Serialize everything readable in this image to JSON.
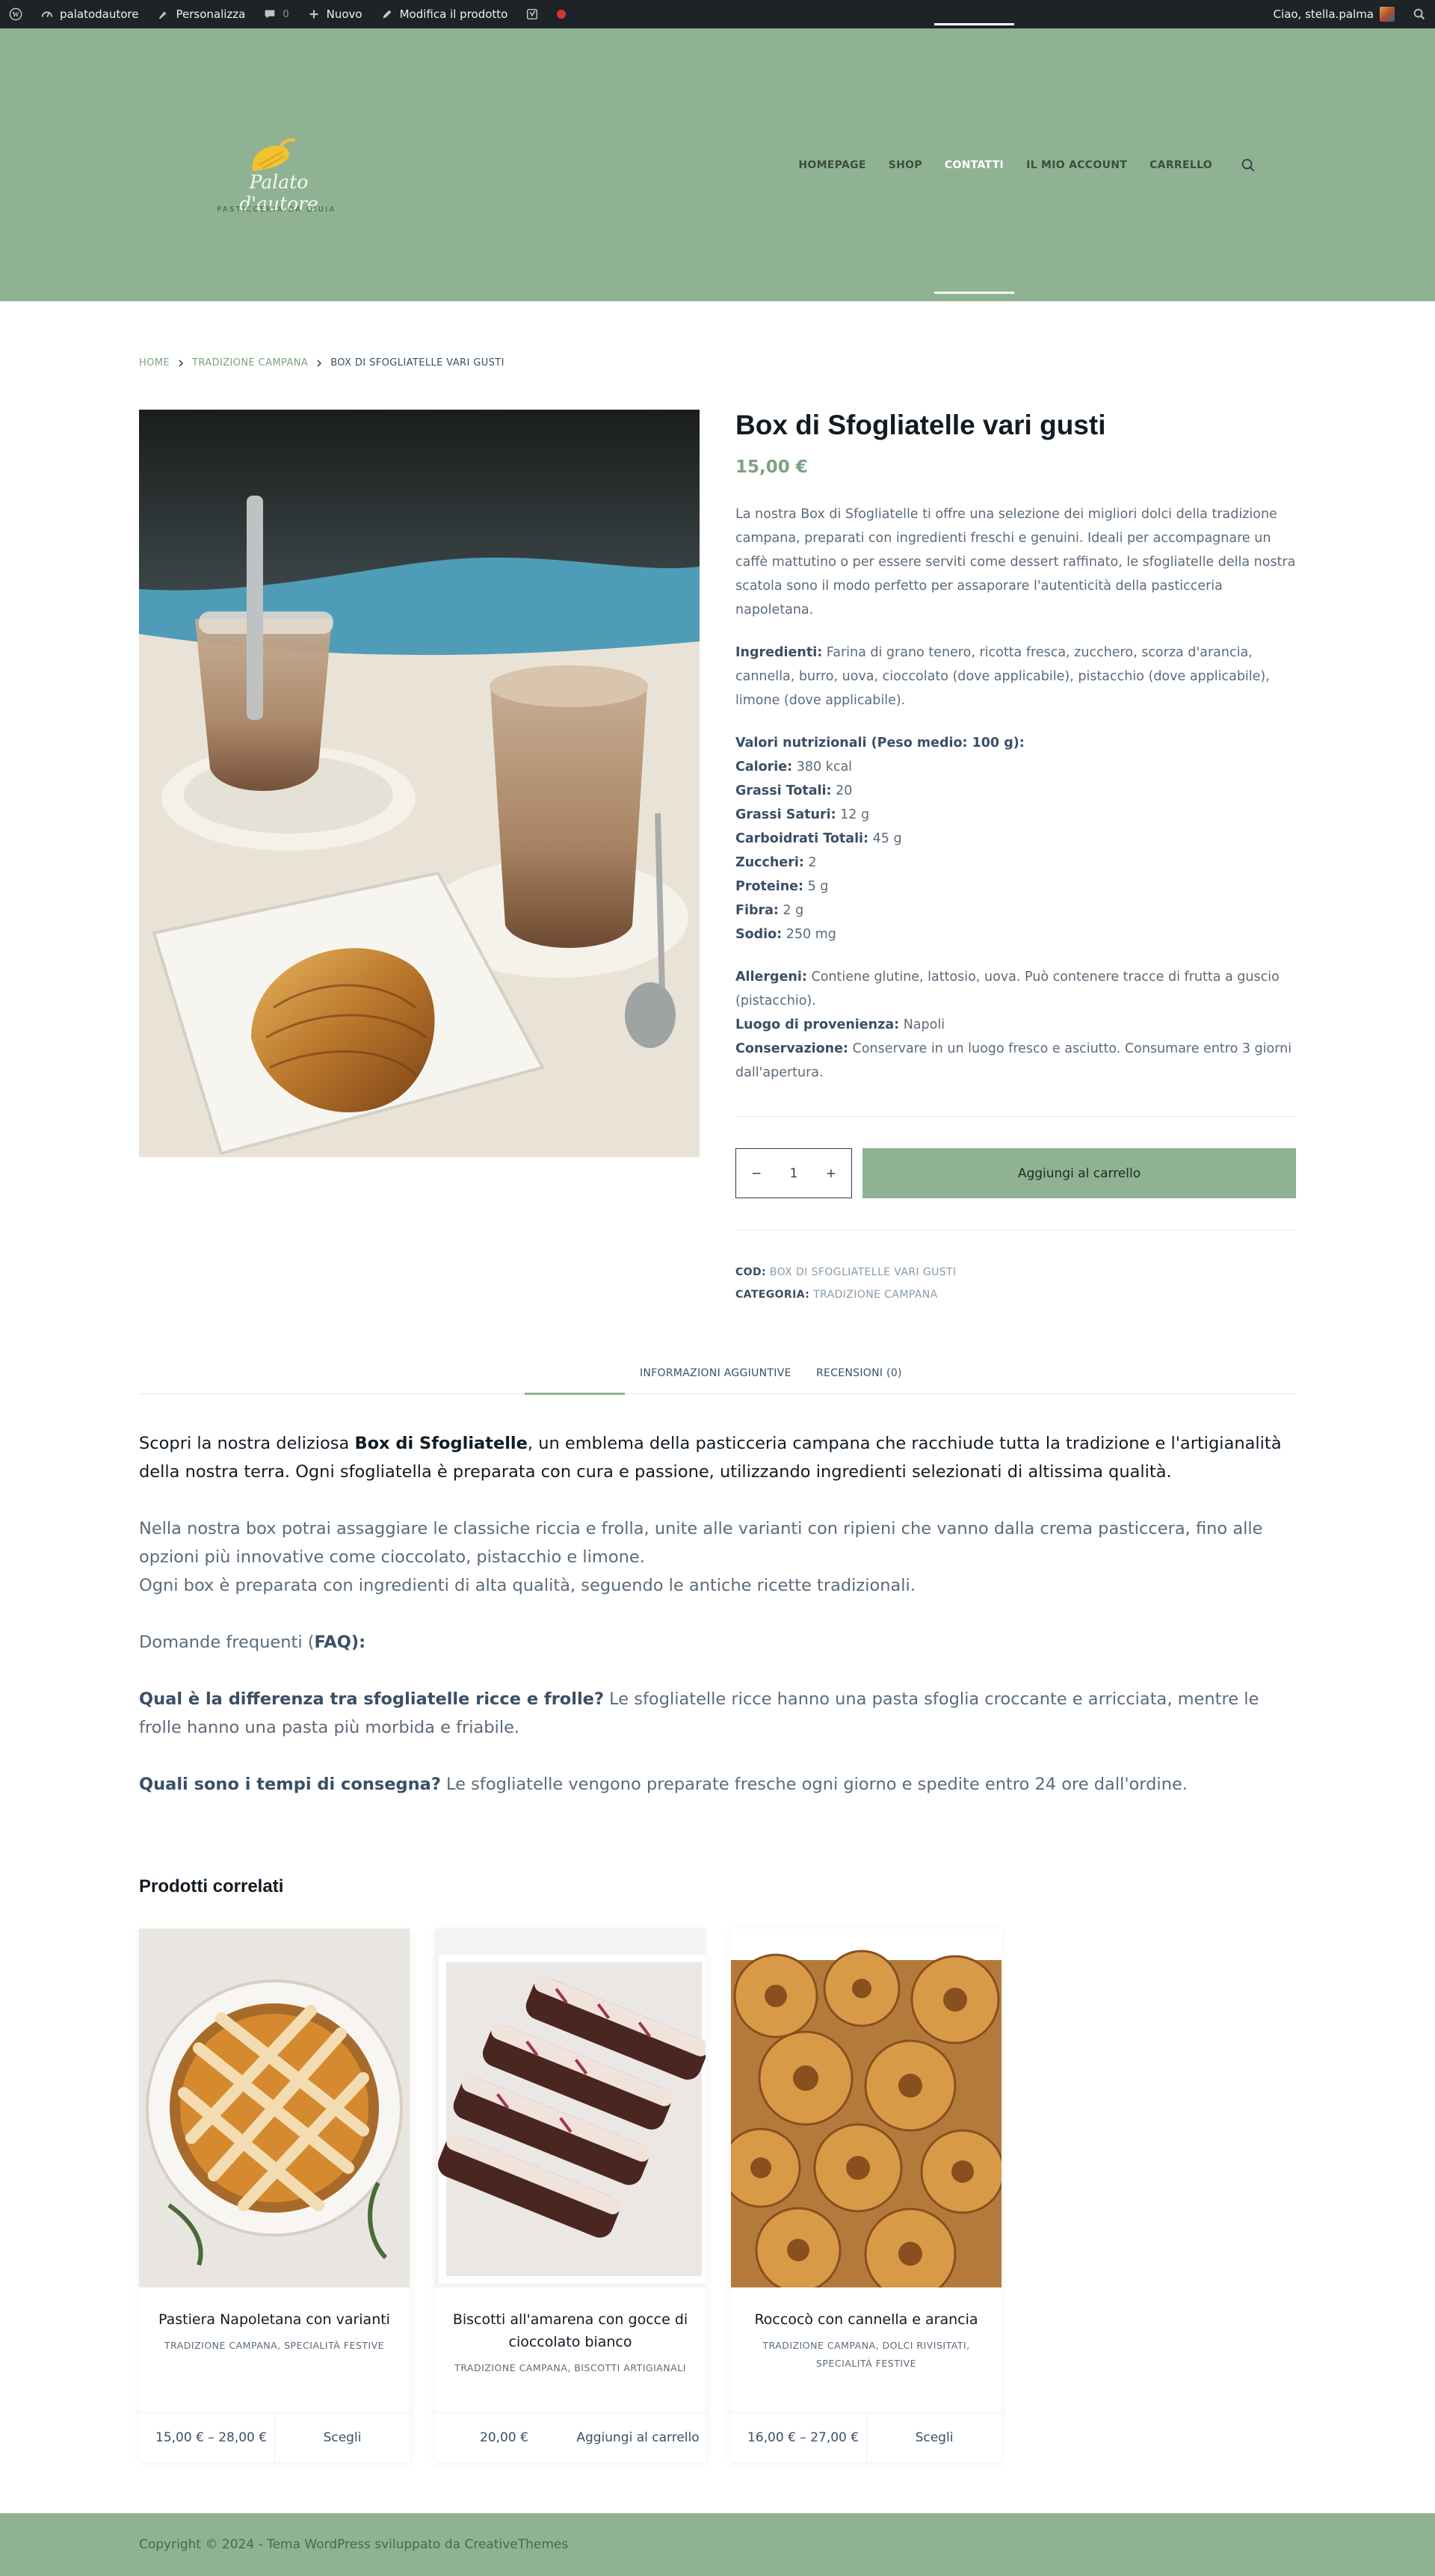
{
  "adminbar": {
    "site_name": "palatodautore",
    "customize": "Personalizza",
    "comments_count": "0",
    "new": "Nuovo",
    "edit_product": "Modifica il prodotto",
    "greeting": "Ciao, stella.palma"
  },
  "header": {
    "logo_script": "Palato d'autore",
    "logo_tagline": "PASTICCERIA DA GIUIA",
    "nav": [
      "HOMEPAGE",
      "SHOP",
      "CONTATTI",
      "IL MIO ACCOUNT",
      "CARRELLO"
    ]
  },
  "breadcrumb": {
    "home": "HOME",
    "category": "TRADIZIONE CAMPANA",
    "current": "BOX DI SFOGLIATELLE VARI GUSTI"
  },
  "product": {
    "title": "Box di Sfogliatelle vari gusti",
    "price": "15,00 €",
    "intro": "La nostra Box di Sfogliatelle ti offre una selezione dei migliori dolci della tradizione campana, preparati con ingredienti freschi e genuini. Ideali per accompagnare un caffè mattutino o per essere serviti come dessert raffinato, le sfogliatelle della nostra scatola sono il modo perfetto per assaporare l'autenticità della pasticceria napoletana.",
    "ingredients_label": "Ingredienti:",
    "ingredients": " Farina di grano tenero, ricotta fresca, zucchero, scorza d'arancia, cannella, burro, uova, cioccolato (dove applicabile), pistacchio (dove applicabile), limone (dove applicabile).",
    "nutrition_title": "Valori nutrizionali (Peso medio: 100 g):",
    "nutrition": [
      {
        "label": "Calorie:",
        "value": " 380 kcal"
      },
      {
        "label": "Grassi Totali:",
        "value": " 20"
      },
      {
        "label": "Grassi Saturi:",
        "value": " 12 g"
      },
      {
        "label": "Carboidrati Totali:",
        "value": " 45 g"
      },
      {
        "label": "Zuccheri:",
        "value": " 2"
      },
      {
        "label": "Proteine:",
        "value": " 5 g"
      },
      {
        "label": "Fibra:",
        "value": " 2 g"
      },
      {
        "label": "Sodio:",
        "value": " 250 mg"
      }
    ],
    "allergens_label": "Allergeni:",
    "allergens": " Contiene glutine, lattosio, uova. Può contenere tracce di frutta a guscio (pistacchio).",
    "origin_label": "Luogo di provenienza:",
    "origin": " Napoli",
    "storage_label": "Conservazione:",
    "storage": " Conservare in un luogo fresco e asciutto. Consumare entro 3 giorni dall'apertura.",
    "quantity": "1",
    "minus": "−",
    "plus": "+",
    "add_to_cart": "Aggiungi al carrello",
    "sku_label": "COD:",
    "sku": "BOX DI SFOGLIATELLE VARI GUSTI",
    "category_label": "CATEGORIA:",
    "category": "TRADIZIONE CAMPANA"
  },
  "tabs": [
    "INFORMAZIONI AGGIUNTIVE",
    "RECENSIONI (0)"
  ],
  "content": {
    "p1_a": "Scopri la nostra deliziosa ",
    "p1_b": "Box di Sfogliatelle",
    "p1_c": ", un emblema della pasticceria campana che racchiude tutta la tradizione e l'artigianalità della nostra terra. Ogni sfogliatella è preparata con cura e passione, utilizzando ingredienti selezionati di altissima qualità.",
    "p2": "Nella nostra box potrai assaggiare le classiche riccia e frolla, unite alle varianti con ripieni che vanno dalla crema pasticcera, fino alle opzioni più innovative come cioccolato, pistacchio e limone.",
    "p2b": "Ogni box è preparata con ingredienti di alta qualità, seguendo le antiche ricette tradizionali.",
    "faq_a": "Domande frequenti (",
    "faq_b": "FAQ):",
    "q1": "Qual è la differenza tra sfogliatelle ricce e frolle?",
    "a1": " Le sfogliatelle ricce hanno una pasta sfoglia croccante e arricciata, mentre le frolle hanno una pasta più morbida e friabile.",
    "q2": "Quali sono i tempi di consegna?",
    "a2": " Le sfogliatelle vengono preparate fresche ogni giorno e spedite entro 24 ore dall'ordine."
  },
  "related": {
    "title": "Prodotti correlati",
    "items": [
      {
        "name": "Pastiera Napoletana con varianti",
        "cats": "TRADIZIONE CAMPANA, SPECIALITÀ FESTIVE",
        "price": "15,00 € – 28,00 €",
        "action": "Scegli"
      },
      {
        "name": "Biscotti all'amarena con gocce di cioccolato bianco",
        "cats": "TRADIZIONE CAMPANA, BISCOTTI ARTIGIANALI",
        "price": "20,00 €",
        "action": "Aggiungi al carrello"
      },
      {
        "name": "Roccocò con cannella e arancia",
        "cats": "TRADIZIONE CAMPANA, DOLCI RIVISITATI, SPECIALITÀ FESTIVE",
        "price": "16,00 € – 27,00 €",
        "action": "Scegli"
      }
    ]
  },
  "footer": {
    "copyright": "Copyright © 2024 - Tema WordPress sviluppato da CreativeThemes"
  }
}
